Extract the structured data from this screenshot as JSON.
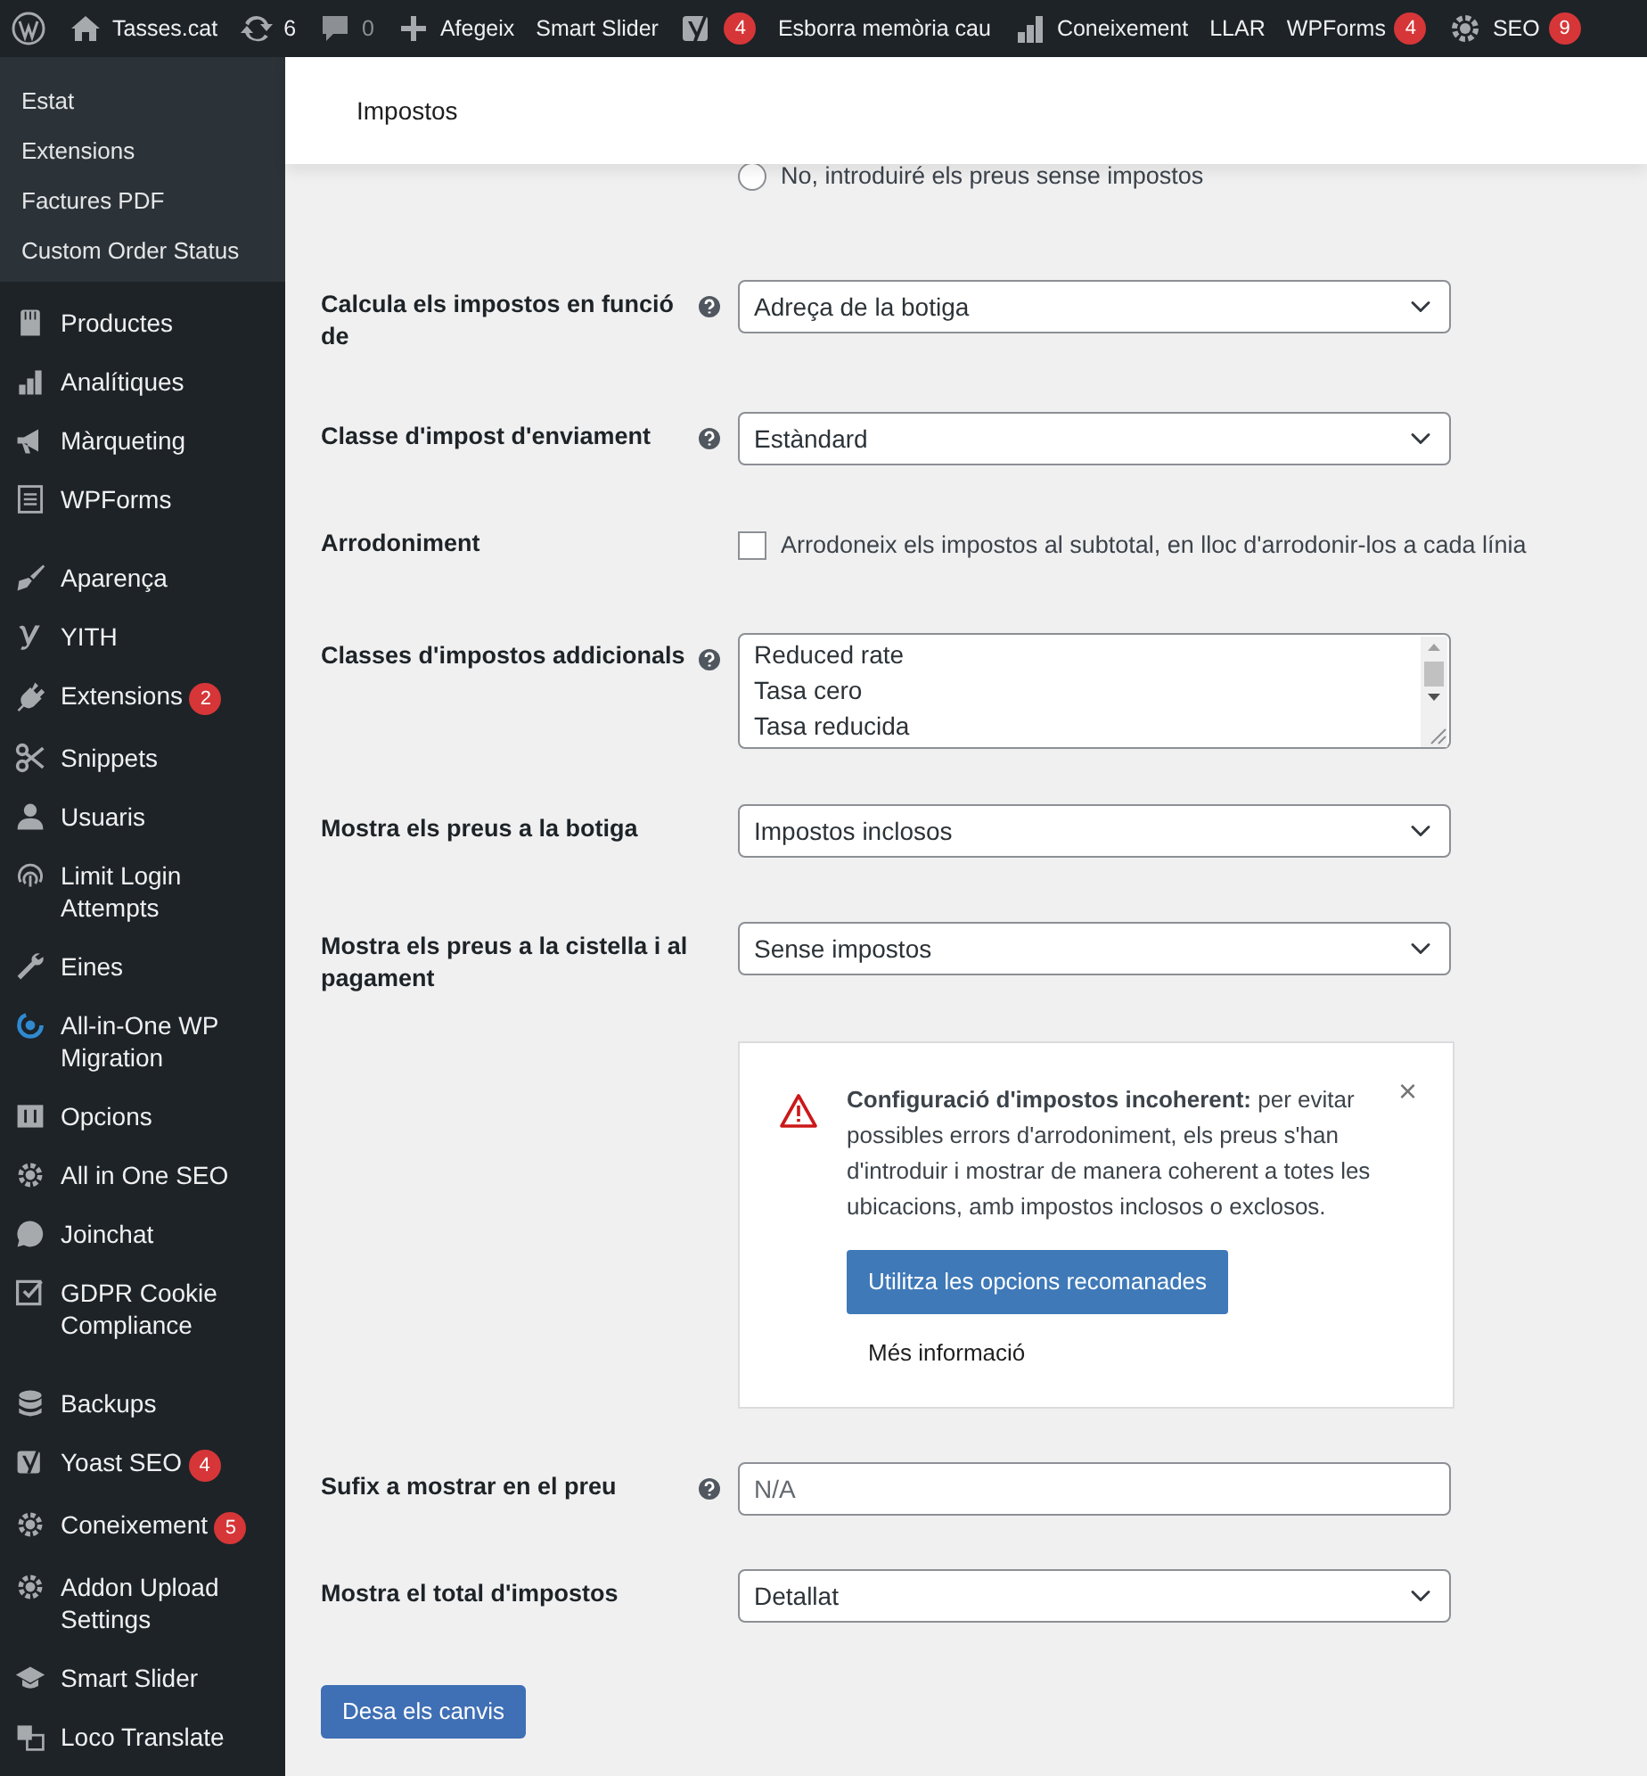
{
  "admin_bar": [
    {
      "kind": "logo"
    },
    {
      "label": "Tasses.cat"
    },
    {
      "label": "6"
    },
    {
      "label": "0"
    },
    {
      "label": "Afegeix"
    },
    {
      "label": "Smart Slider"
    },
    {
      "badge": "4"
    },
    {
      "label": "Esborra memòria cau"
    },
    {
      "label": "Coneixement"
    },
    {
      "label": "LLAR"
    },
    {
      "label": "WPForms",
      "badge": "4"
    },
    {
      "label": "SEO",
      "badge": "9"
    }
  ],
  "sidebar": {
    "submenu": [
      "Estat",
      "Extensions",
      "Factures PDF",
      "Custom Order Status"
    ],
    "items": [
      {
        "kind": "item",
        "label": "Productes"
      },
      {
        "kind": "item",
        "label": "Analítiques"
      },
      {
        "kind": "item",
        "label": "Màrqueting"
      },
      {
        "kind": "item",
        "label": "WPForms"
      },
      {
        "kind": "separator"
      },
      {
        "kind": "item",
        "label": "Aparença"
      },
      {
        "kind": "item",
        "label": "YITH"
      },
      {
        "kind": "item",
        "label": "Extensions",
        "badge": "2"
      },
      {
        "kind": "item",
        "label": "Snippets"
      },
      {
        "kind": "item",
        "label": "Usuaris"
      },
      {
        "kind": "item",
        "label": "Limit Login Attempts"
      },
      {
        "kind": "item",
        "label": "Eines"
      },
      {
        "kind": "item",
        "label": "All-in-One WP Migration"
      },
      {
        "kind": "item",
        "label": "Opcions"
      },
      {
        "kind": "item",
        "label": "All in One SEO"
      },
      {
        "kind": "item",
        "label": "Joinchat"
      },
      {
        "kind": "item",
        "label": "GDPR Cookie Compliance"
      },
      {
        "kind": "separator"
      },
      {
        "kind": "item",
        "label": "Backups"
      },
      {
        "kind": "item",
        "label": "Yoast SEO",
        "badge": "4"
      },
      {
        "kind": "item",
        "label": "Coneixement",
        "badge": "5"
      },
      {
        "kind": "item",
        "label": "Addon Upload Settings"
      },
      {
        "kind": "item",
        "label": "Smart Slider"
      },
      {
        "kind": "item",
        "label": "Loco Translate"
      }
    ]
  },
  "header": {
    "title": "Impostos"
  },
  "settings": [
    {
      "kind": "radio",
      "help": false,
      "text": "No, introduiré els preus sense impostos",
      "checked": false
    },
    {
      "kind": "select",
      "label": "Calcula els impostos en funció de",
      "help": true,
      "value": "Adreça de la botiga"
    },
    {
      "kind": "select",
      "label": "Classe d'impost d'enviament",
      "help": true,
      "value": "Estàndard"
    },
    {
      "kind": "checkbox",
      "label": "Arrodoniment",
      "help": false,
      "text": "Arrodoneix els impostos al subtotal, en lloc d'arrodonir-los a cada línia",
      "checked": false
    },
    {
      "kind": "textarea",
      "label": "Classes d'impostos addicionals",
      "help": true,
      "lines": [
        "Reduced rate",
        "Tasa cero",
        "Tasa reducida"
      ]
    },
    {
      "kind": "select",
      "label": "Mostra els preus a la botiga",
      "help": false,
      "value": "Impostos inclosos"
    },
    {
      "kind": "select",
      "label": "Mostra els preus a la cistella i al pagament",
      "help": false,
      "value": "Sense impostos"
    },
    {
      "kind": "notice",
      "text": "**Configuració d'impostos incoherent:** per evitar possibles errors d'arrodoniment, els preus s'han d'introduir i mostrar de manera coherent a totes les ubicacions, amb impostos inclosos o exclosos.",
      "close": "×",
      "button": "Utilitza les opcions recomanades",
      "link": "Més informació"
    },
    {
      "kind": "text",
      "label": "Sufix a mostrar en el preu",
      "help": true,
      "placeholder": "N/A"
    },
    {
      "kind": "select",
      "label": "Mostra el total d'impostos",
      "help": false,
      "value": "Detallat"
    }
  ],
  "save_button": "Desa els canvis"
}
